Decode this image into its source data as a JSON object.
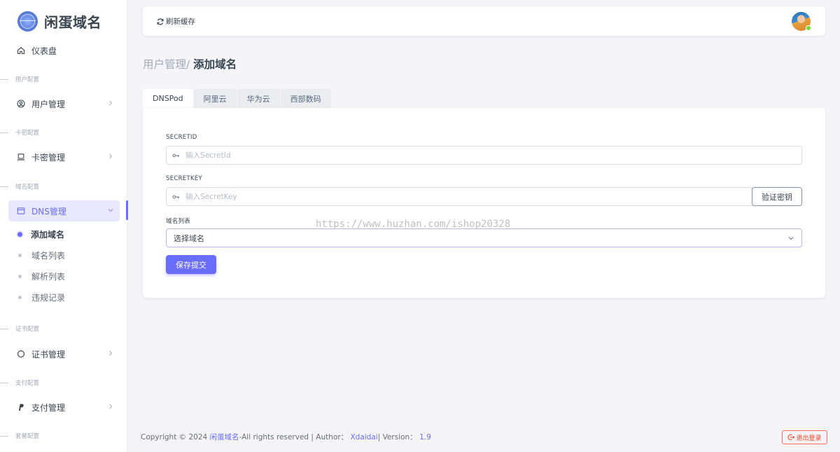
{
  "brand": {
    "name": "闲蛋域名"
  },
  "sidebar": {
    "dashboard": {
      "label": "仪表盘",
      "icon": "home-icon"
    },
    "sections": [
      {
        "header": "用户配置",
        "item": {
          "label": "用户管理",
          "icon": "user-circle-icon"
        }
      },
      {
        "header": "卡密配置",
        "item": {
          "label": "卡密管理",
          "icon": "laptop-icon"
        }
      },
      {
        "header": "域名配置",
        "item": {
          "label": "DNS管理",
          "icon": "window-icon"
        }
      },
      {
        "header": "证书配置",
        "item": {
          "label": "证书管理",
          "icon": "badge-icon"
        }
      },
      {
        "header": "支付配置",
        "item": {
          "label": "支付管理",
          "icon": "paypal-icon"
        }
      },
      {
        "header": "套餐配置"
      }
    ],
    "dns_subitems": [
      "添加域名",
      "域名列表",
      "解析列表",
      "违规记录"
    ],
    "active_subitem": "添加域名"
  },
  "navbar": {
    "refresh_label": "刷新缓存"
  },
  "breadcrumb": {
    "parent": "用户管理/",
    "current": "添加域名"
  },
  "tabs": [
    "DNSPod",
    "阿里云",
    "华为云",
    "西部数码"
  ],
  "active_tab": "DNSPod",
  "form": {
    "secret_id_label": "SECRETID",
    "secret_id_placeholder": "输入SecretId",
    "secret_key_label": "SECRETKEY",
    "secret_key_placeholder": "输入SecretKey",
    "verify_label": "验证密钥",
    "domain_list_label": "域名列表",
    "domain_select_value": "选择域名",
    "submit_label": "保存提交"
  },
  "watermark": "https://www.huzhan.com/ishop20328",
  "footer": {
    "copyright": "Copyright © 2024",
    "brand_link": "闲蛋域名",
    "rights": "-All rights reserved | Author：",
    "author": "Xdaidai",
    "version_label": " | Version：",
    "version": "1.9",
    "logout_label": "退出登录"
  },
  "colors": {
    "accent": "#696cff",
    "danger": "#ff3e1d",
    "text": "#384551"
  }
}
